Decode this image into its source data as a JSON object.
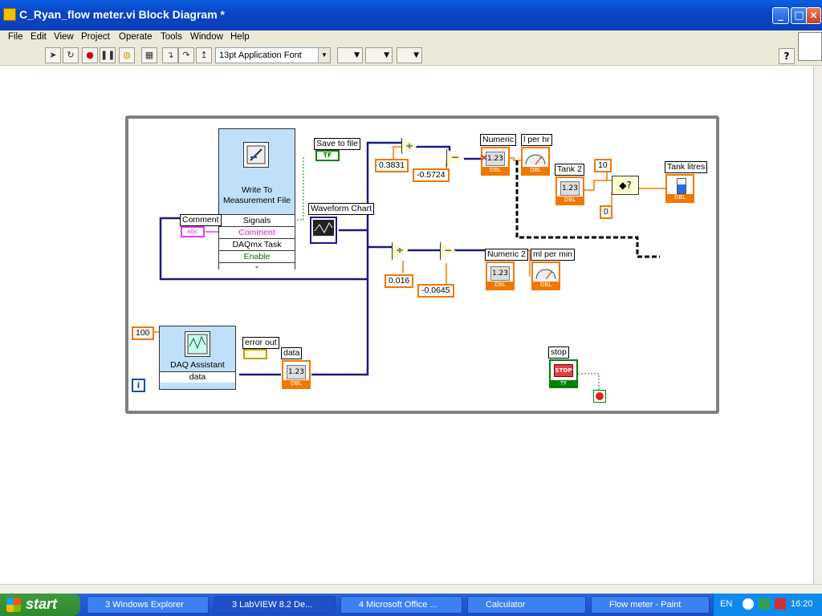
{
  "window": {
    "title": "C_Ryan_flow meter.vi Block Diagram *",
    "minimize": "_",
    "maximize": "□",
    "close": "×"
  },
  "menu": [
    "File",
    "Edit",
    "View",
    "Project",
    "Operate",
    "Tools",
    "Window",
    "Help"
  ],
  "toolbar": {
    "font": "13pt Application Font",
    "help": "?"
  },
  "diagram": {
    "wtmf": {
      "title": "Write To Measurement File",
      "terminals": [
        "Signals",
        "Comment",
        "DAQmx Task",
        "Enable"
      ]
    },
    "daq": {
      "title": "DAQ Assistant",
      "output": "data"
    },
    "labels": {
      "comment": "Comment",
      "save_to_file": "Save to file",
      "waveform_chart": "Waveform Chart",
      "numeric": "Numeric",
      "l_per_hr": "l per hr",
      "tank2": "Tank 2",
      "tank_litres": "Tank litres",
      "numeric2": "Numeric 2",
      "ml_per_min": "ml per min",
      "error_out": "error out",
      "data": "data",
      "stop": "stop"
    },
    "constants": {
      "c1": "0.3831",
      "c2": "-0.5724",
      "c3": "0.016",
      "c4": "-0.0645",
      "c10": "10",
      "c0": "0",
      "c100": "100",
      "iter": "i"
    },
    "tf_text": "TF",
    "stop_text": "STOP",
    "abc_text": "abc",
    "num_text": "1.23",
    "dbl_text": "DBL"
  },
  "taskbar": {
    "start": "start",
    "tasks": [
      "3 Windows Explorer",
      "3 LabVIEW 8.2 De...",
      "4 Microsoft Office ...",
      "Calculator",
      "Flow meter - Paint"
    ],
    "lang": "EN",
    "clock": "16:20"
  }
}
